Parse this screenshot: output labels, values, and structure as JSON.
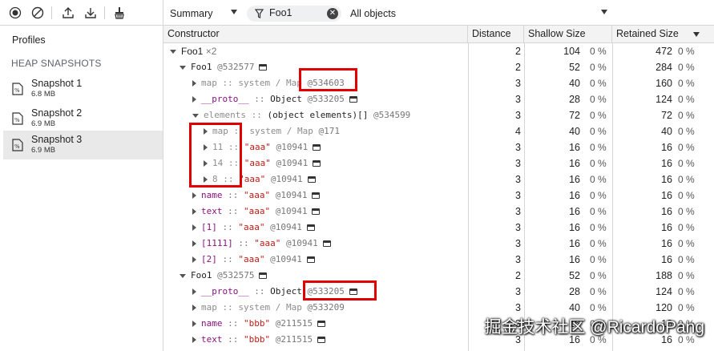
{
  "toolbar": {
    "icons": [
      "record-icon",
      "clear-icon",
      "upload-icon",
      "download-icon",
      "collect-garbage-icon"
    ],
    "view_select": "Summary",
    "filter_value": "Foo1",
    "objects_select": "All objects"
  },
  "sidebar": {
    "profiles_label": "Profiles",
    "section_label": "HEAP SNAPSHOTS",
    "snapshots": [
      {
        "name": "Snapshot 1",
        "size": "6.8 MB"
      },
      {
        "name": "Snapshot 2",
        "size": "6.9 MB"
      },
      {
        "name": "Snapshot 3",
        "size": "6.9 MB"
      }
    ],
    "selected_index": 2
  },
  "table": {
    "columns": {
      "constructor": "Constructor",
      "distance": "Distance",
      "shallow": "Shallow Size",
      "retained": "Retained Size"
    },
    "rows": [
      {
        "depth": 0,
        "expander": "down",
        "parts": [
          {
            "t": "Foo1",
            "c": ""
          },
          {
            "t": " ×2",
            "c": "cnt"
          }
        ],
        "obj_icon": false,
        "distance": "2",
        "shallow": "104",
        "shallow_pct": "0 %",
        "retained": "472",
        "retained_pct": "0 %"
      },
      {
        "depth": 1,
        "expander": "down",
        "parts": [
          {
            "t": "Foo1",
            "c": ""
          },
          {
            "t": " @532577",
            "c": "c-dim"
          }
        ],
        "obj_icon": true,
        "distance": "2",
        "shallow": "52",
        "shallow_pct": "0 %",
        "retained": "284",
        "retained_pct": "0 %"
      },
      {
        "depth": 2,
        "expander": "right",
        "parts": [
          {
            "t": "map",
            "c": "c-gray"
          },
          {
            "t": " :: ",
            "c": "c-gray"
          },
          {
            "t": "system / Map",
            "c": "c-gray"
          },
          {
            "t": " @534603",
            "c": "c-dim"
          }
        ],
        "obj_icon": false,
        "distance": "3",
        "shallow": "40",
        "shallow_pct": "0 %",
        "retained": "160",
        "retained_pct": "0 %"
      },
      {
        "depth": 2,
        "expander": "right",
        "parts": [
          {
            "t": "__proto__",
            "c": "c-purple"
          },
          {
            "t": " :: ",
            "c": "c-dim"
          },
          {
            "t": "Object",
            "c": ""
          },
          {
            "t": " @533205",
            "c": "c-dim"
          }
        ],
        "obj_icon": true,
        "distance": "3",
        "shallow": "28",
        "shallow_pct": "0 %",
        "retained": "124",
        "retained_pct": "0 %"
      },
      {
        "depth": 2,
        "expander": "down",
        "parts": [
          {
            "t": "elements",
            "c": "c-gray"
          },
          {
            "t": " :: ",
            "c": "c-gray"
          },
          {
            "t": "(object elements)[]",
            "c": ""
          },
          {
            "t": " @534599",
            "c": "c-dim"
          }
        ],
        "obj_icon": false,
        "distance": "3",
        "shallow": "72",
        "shallow_pct": "0 %",
        "retained": "72",
        "retained_pct": "0 %"
      },
      {
        "depth": 3,
        "expander": "right",
        "parts": [
          {
            "t": "map",
            "c": "c-gray"
          },
          {
            "t": " :: ",
            "c": "c-gray"
          },
          {
            "t": "system / Map",
            "c": "c-gray"
          },
          {
            "t": " @171",
            "c": "c-dim"
          }
        ],
        "obj_icon": false,
        "distance": "4",
        "shallow": "40",
        "shallow_pct": "0 %",
        "retained": "40",
        "retained_pct": "0 %"
      },
      {
        "depth": 3,
        "expander": "right",
        "parts": [
          {
            "t": "11",
            "c": "c-gray"
          },
          {
            "t": " :: ",
            "c": "c-gray"
          },
          {
            "t": "\"aaa\"",
            "c": "c-red"
          },
          {
            "t": " @10941",
            "c": "c-dim"
          }
        ],
        "obj_icon": true,
        "distance": "3",
        "shallow": "16",
        "shallow_pct": "0 %",
        "retained": "16",
        "retained_pct": "0 %"
      },
      {
        "depth": 3,
        "expander": "right",
        "parts": [
          {
            "t": "14",
            "c": "c-gray"
          },
          {
            "t": " :: ",
            "c": "c-gray"
          },
          {
            "t": "\"aaa\"",
            "c": "c-red"
          },
          {
            "t": " @10941",
            "c": "c-dim"
          }
        ],
        "obj_icon": true,
        "distance": "3",
        "shallow": "16",
        "shallow_pct": "0 %",
        "retained": "16",
        "retained_pct": "0 %"
      },
      {
        "depth": 3,
        "expander": "right",
        "parts": [
          {
            "t": "8",
            "c": "c-gray"
          },
          {
            "t": " :: ",
            "c": "c-gray"
          },
          {
            "t": "\"aaa\"",
            "c": "c-red"
          },
          {
            "t": " @10941",
            "c": "c-dim"
          }
        ],
        "obj_icon": true,
        "distance": "3",
        "shallow": "16",
        "shallow_pct": "0 %",
        "retained": "16",
        "retained_pct": "0 %"
      },
      {
        "depth": 2,
        "expander": "right",
        "parts": [
          {
            "t": "name",
            "c": "c-purple"
          },
          {
            "t": " :: ",
            "c": "c-dim"
          },
          {
            "t": "\"aaa\"",
            "c": "c-red"
          },
          {
            "t": " @10941",
            "c": "c-dim"
          }
        ],
        "obj_icon": true,
        "distance": "3",
        "shallow": "16",
        "shallow_pct": "0 %",
        "retained": "16",
        "retained_pct": "0 %"
      },
      {
        "depth": 2,
        "expander": "right",
        "parts": [
          {
            "t": "text",
            "c": "c-purple"
          },
          {
            "t": " :: ",
            "c": "c-dim"
          },
          {
            "t": "\"aaa\"",
            "c": "c-red"
          },
          {
            "t": " @10941",
            "c": "c-dim"
          }
        ],
        "obj_icon": true,
        "distance": "3",
        "shallow": "16",
        "shallow_pct": "0 %",
        "retained": "16",
        "retained_pct": "0 %"
      },
      {
        "depth": 2,
        "expander": "right",
        "parts": [
          {
            "t": "[1]",
            "c": "c-purple"
          },
          {
            "t": " :: ",
            "c": "c-dim"
          },
          {
            "t": "\"aaa\"",
            "c": "c-red"
          },
          {
            "t": " @10941",
            "c": "c-dim"
          }
        ],
        "obj_icon": true,
        "distance": "3",
        "shallow": "16",
        "shallow_pct": "0 %",
        "retained": "16",
        "retained_pct": "0 %"
      },
      {
        "depth": 2,
        "expander": "right",
        "parts": [
          {
            "t": "[1111]",
            "c": "c-purple"
          },
          {
            "t": " :: ",
            "c": "c-dim"
          },
          {
            "t": "\"aaa\"",
            "c": "c-red"
          },
          {
            "t": " @10941",
            "c": "c-dim"
          }
        ],
        "obj_icon": true,
        "distance": "3",
        "shallow": "16",
        "shallow_pct": "0 %",
        "retained": "16",
        "retained_pct": "0 %"
      },
      {
        "depth": 2,
        "expander": "right",
        "parts": [
          {
            "t": "[2]",
            "c": "c-purple"
          },
          {
            "t": " :: ",
            "c": "c-dim"
          },
          {
            "t": "\"aaa\"",
            "c": "c-red"
          },
          {
            "t": " @10941",
            "c": "c-dim"
          }
        ],
        "obj_icon": true,
        "distance": "3",
        "shallow": "16",
        "shallow_pct": "0 %",
        "retained": "16",
        "retained_pct": "0 %"
      },
      {
        "depth": 1,
        "expander": "down",
        "parts": [
          {
            "t": "Foo1",
            "c": ""
          },
          {
            "t": " @532575",
            "c": "c-dim"
          }
        ],
        "obj_icon": true,
        "distance": "2",
        "shallow": "52",
        "shallow_pct": "0 %",
        "retained": "188",
        "retained_pct": "0 %"
      },
      {
        "depth": 2,
        "expander": "right",
        "parts": [
          {
            "t": "__proto__",
            "c": "c-purple"
          },
          {
            "t": " :: ",
            "c": "c-dim"
          },
          {
            "t": "Object",
            "c": ""
          },
          {
            "t": " @533205",
            "c": "c-dim"
          }
        ],
        "obj_icon": true,
        "distance": "3",
        "shallow": "28",
        "shallow_pct": "0 %",
        "retained": "124",
        "retained_pct": "0 %"
      },
      {
        "depth": 2,
        "expander": "right",
        "parts": [
          {
            "t": "map",
            "c": "c-gray"
          },
          {
            "t": " :: ",
            "c": "c-gray"
          },
          {
            "t": "system / Map",
            "c": "c-gray"
          },
          {
            "t": " @533209",
            "c": "c-dim"
          }
        ],
        "obj_icon": false,
        "distance": "3",
        "shallow": "40",
        "shallow_pct": "0 %",
        "retained": "120",
        "retained_pct": "0 %"
      },
      {
        "depth": 2,
        "expander": "right",
        "parts": [
          {
            "t": "name",
            "c": "c-purple"
          },
          {
            "t": " :: ",
            "c": "c-dim"
          },
          {
            "t": "\"bbb\"",
            "c": "c-red"
          },
          {
            "t": " @211515",
            "c": "c-dim"
          }
        ],
        "obj_icon": true,
        "distance": "3",
        "shallow": "16",
        "shallow_pct": "0 %",
        "retained": "16",
        "retained_pct": "0 %"
      },
      {
        "depth": 2,
        "expander": "right",
        "parts": [
          {
            "t": "text",
            "c": "c-purple"
          },
          {
            "t": " :: ",
            "c": "c-dim"
          },
          {
            "t": "\"bbb\"",
            "c": "c-red"
          },
          {
            "t": " @211515",
            "c": "c-dim"
          }
        ],
        "obj_icon": true,
        "distance": "3",
        "shallow": "16",
        "shallow_pct": "0 %",
        "retained": "16",
        "retained_pct": "0 %"
      }
    ]
  },
  "watermark": "掘金技术社区 @RicardoPang",
  "colors": {
    "highlight": "#e00000",
    "property": "#881280",
    "string": "#c41a16"
  }
}
